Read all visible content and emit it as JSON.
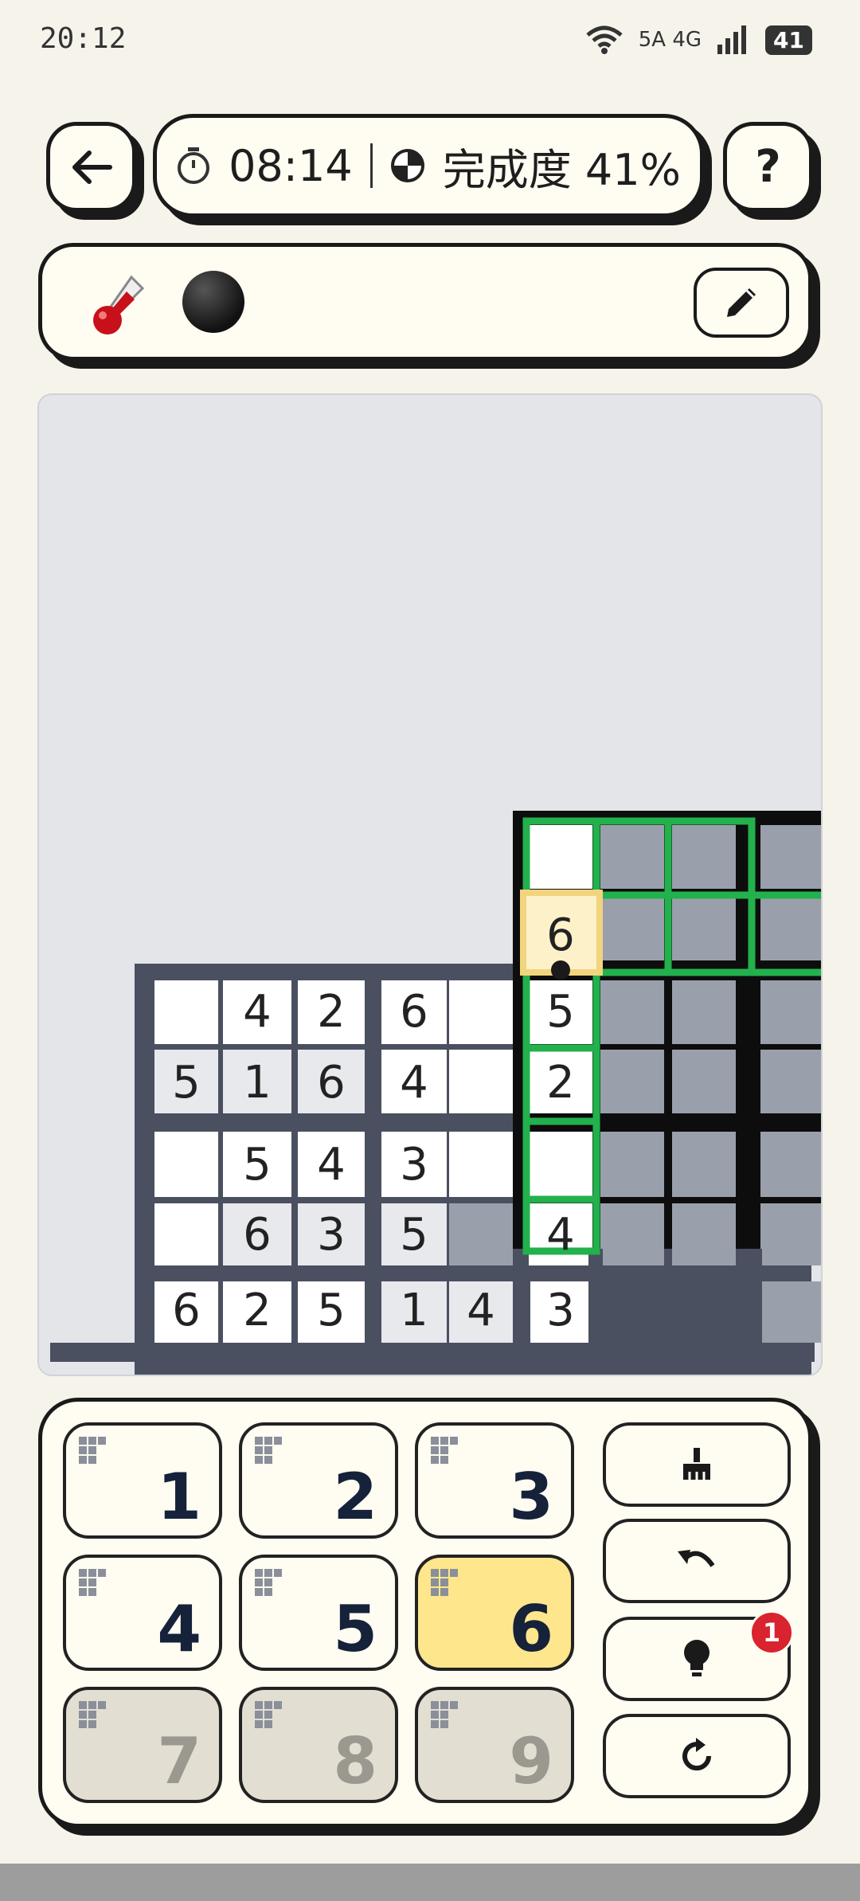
{
  "status_bar": {
    "time": "20:12",
    "network": "5A  4G",
    "battery": "41"
  },
  "header": {
    "timer": "08:14",
    "progress_label": "完成度 41%",
    "help_label": "?"
  },
  "keypad": {
    "keys": [
      {
        "label": "1",
        "state": "normal"
      },
      {
        "label": "2",
        "state": "normal"
      },
      {
        "label": "3",
        "state": "normal"
      },
      {
        "label": "4",
        "state": "normal"
      },
      {
        "label": "5",
        "state": "normal"
      },
      {
        "label": "6",
        "state": "selected"
      },
      {
        "label": "7",
        "state": "disabled"
      },
      {
        "label": "8",
        "state": "disabled"
      },
      {
        "label": "9",
        "state": "disabled"
      }
    ],
    "hint_count": "1"
  },
  "board": {
    "cells": [
      {
        "v": "4",
        "c": 1,
        "r": 0
      },
      {
        "v": "2",
        "c": 2,
        "r": 0
      },
      {
        "v": "6",
        "c": 3,
        "r": 0
      },
      {
        "v": "5",
        "c": 5,
        "r": 0
      },
      {
        "v": "5",
        "c": 0,
        "r": 1
      },
      {
        "v": "1",
        "c": 1,
        "r": 1
      },
      {
        "v": "6",
        "c": 2,
        "r": 1
      },
      {
        "v": "4",
        "c": 3,
        "r": 1
      },
      {
        "v": "2",
        "c": 5,
        "r": 1
      },
      {
        "v": "5",
        "c": 1,
        "r": 2
      },
      {
        "v": "4",
        "c": 2,
        "r": 2
      },
      {
        "v": "3",
        "c": 3,
        "r": 2
      },
      {
        "v": "6",
        "c": 1,
        "r": 3
      },
      {
        "v": "3",
        "c": 2,
        "r": 3
      },
      {
        "v": "5",
        "c": 3,
        "r": 3
      },
      {
        "v": "4",
        "c": 5,
        "r": 3
      },
      {
        "v": "6",
        "c": 0,
        "r": 4
      },
      {
        "v": "2",
        "c": 1,
        "r": 4
      },
      {
        "v": "5",
        "c": 2,
        "r": 4
      },
      {
        "v": "1",
        "c": 3,
        "r": 4
      },
      {
        "v": "4",
        "c": 4,
        "r": 4
      },
      {
        "v": "3",
        "c": 5,
        "r": 4
      }
    ],
    "selected_value": "6"
  },
  "colors": {
    "accent_green": "#22b14c",
    "selection": "#f2d47e",
    "key_selected": "#fde68c",
    "hint_badge": "#d9232e"
  }
}
